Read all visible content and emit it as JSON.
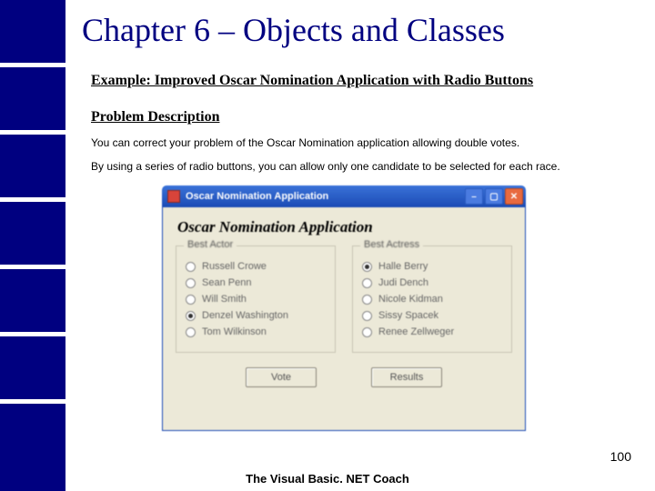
{
  "chapter_title": "Chapter 6 – Objects and Classes",
  "example_line": "Example: Improved Oscar Nomination Application with Radio Buttons",
  "problem_desc": "Problem Description",
  "body_1": "You can correct your problem of the Oscar Nomination application allowing double votes.",
  "body_2": "By using a series of radio buttons, you can allow only one candidate to be selected for each race.",
  "app": {
    "title": "Oscar Nomination Application",
    "heading": "Oscar Nomination Application",
    "group_actor": "Best Actor",
    "group_actress": "Best Actress",
    "actors": [
      "Russell Crowe",
      "Sean Penn",
      "Will Smith",
      "Denzel Washington",
      "Tom Wilkinson"
    ],
    "actor_selected_index": 3,
    "actresses": [
      "Halle Berry",
      "Judi Dench",
      "Nicole Kidman",
      "Sissy Spacek",
      "Renee Zellweger"
    ],
    "actress_selected_index": 0,
    "vote_label": "Vote",
    "results_label": "Results"
  },
  "page_number": "100",
  "footer": "The Visual Basic. NET Coach"
}
